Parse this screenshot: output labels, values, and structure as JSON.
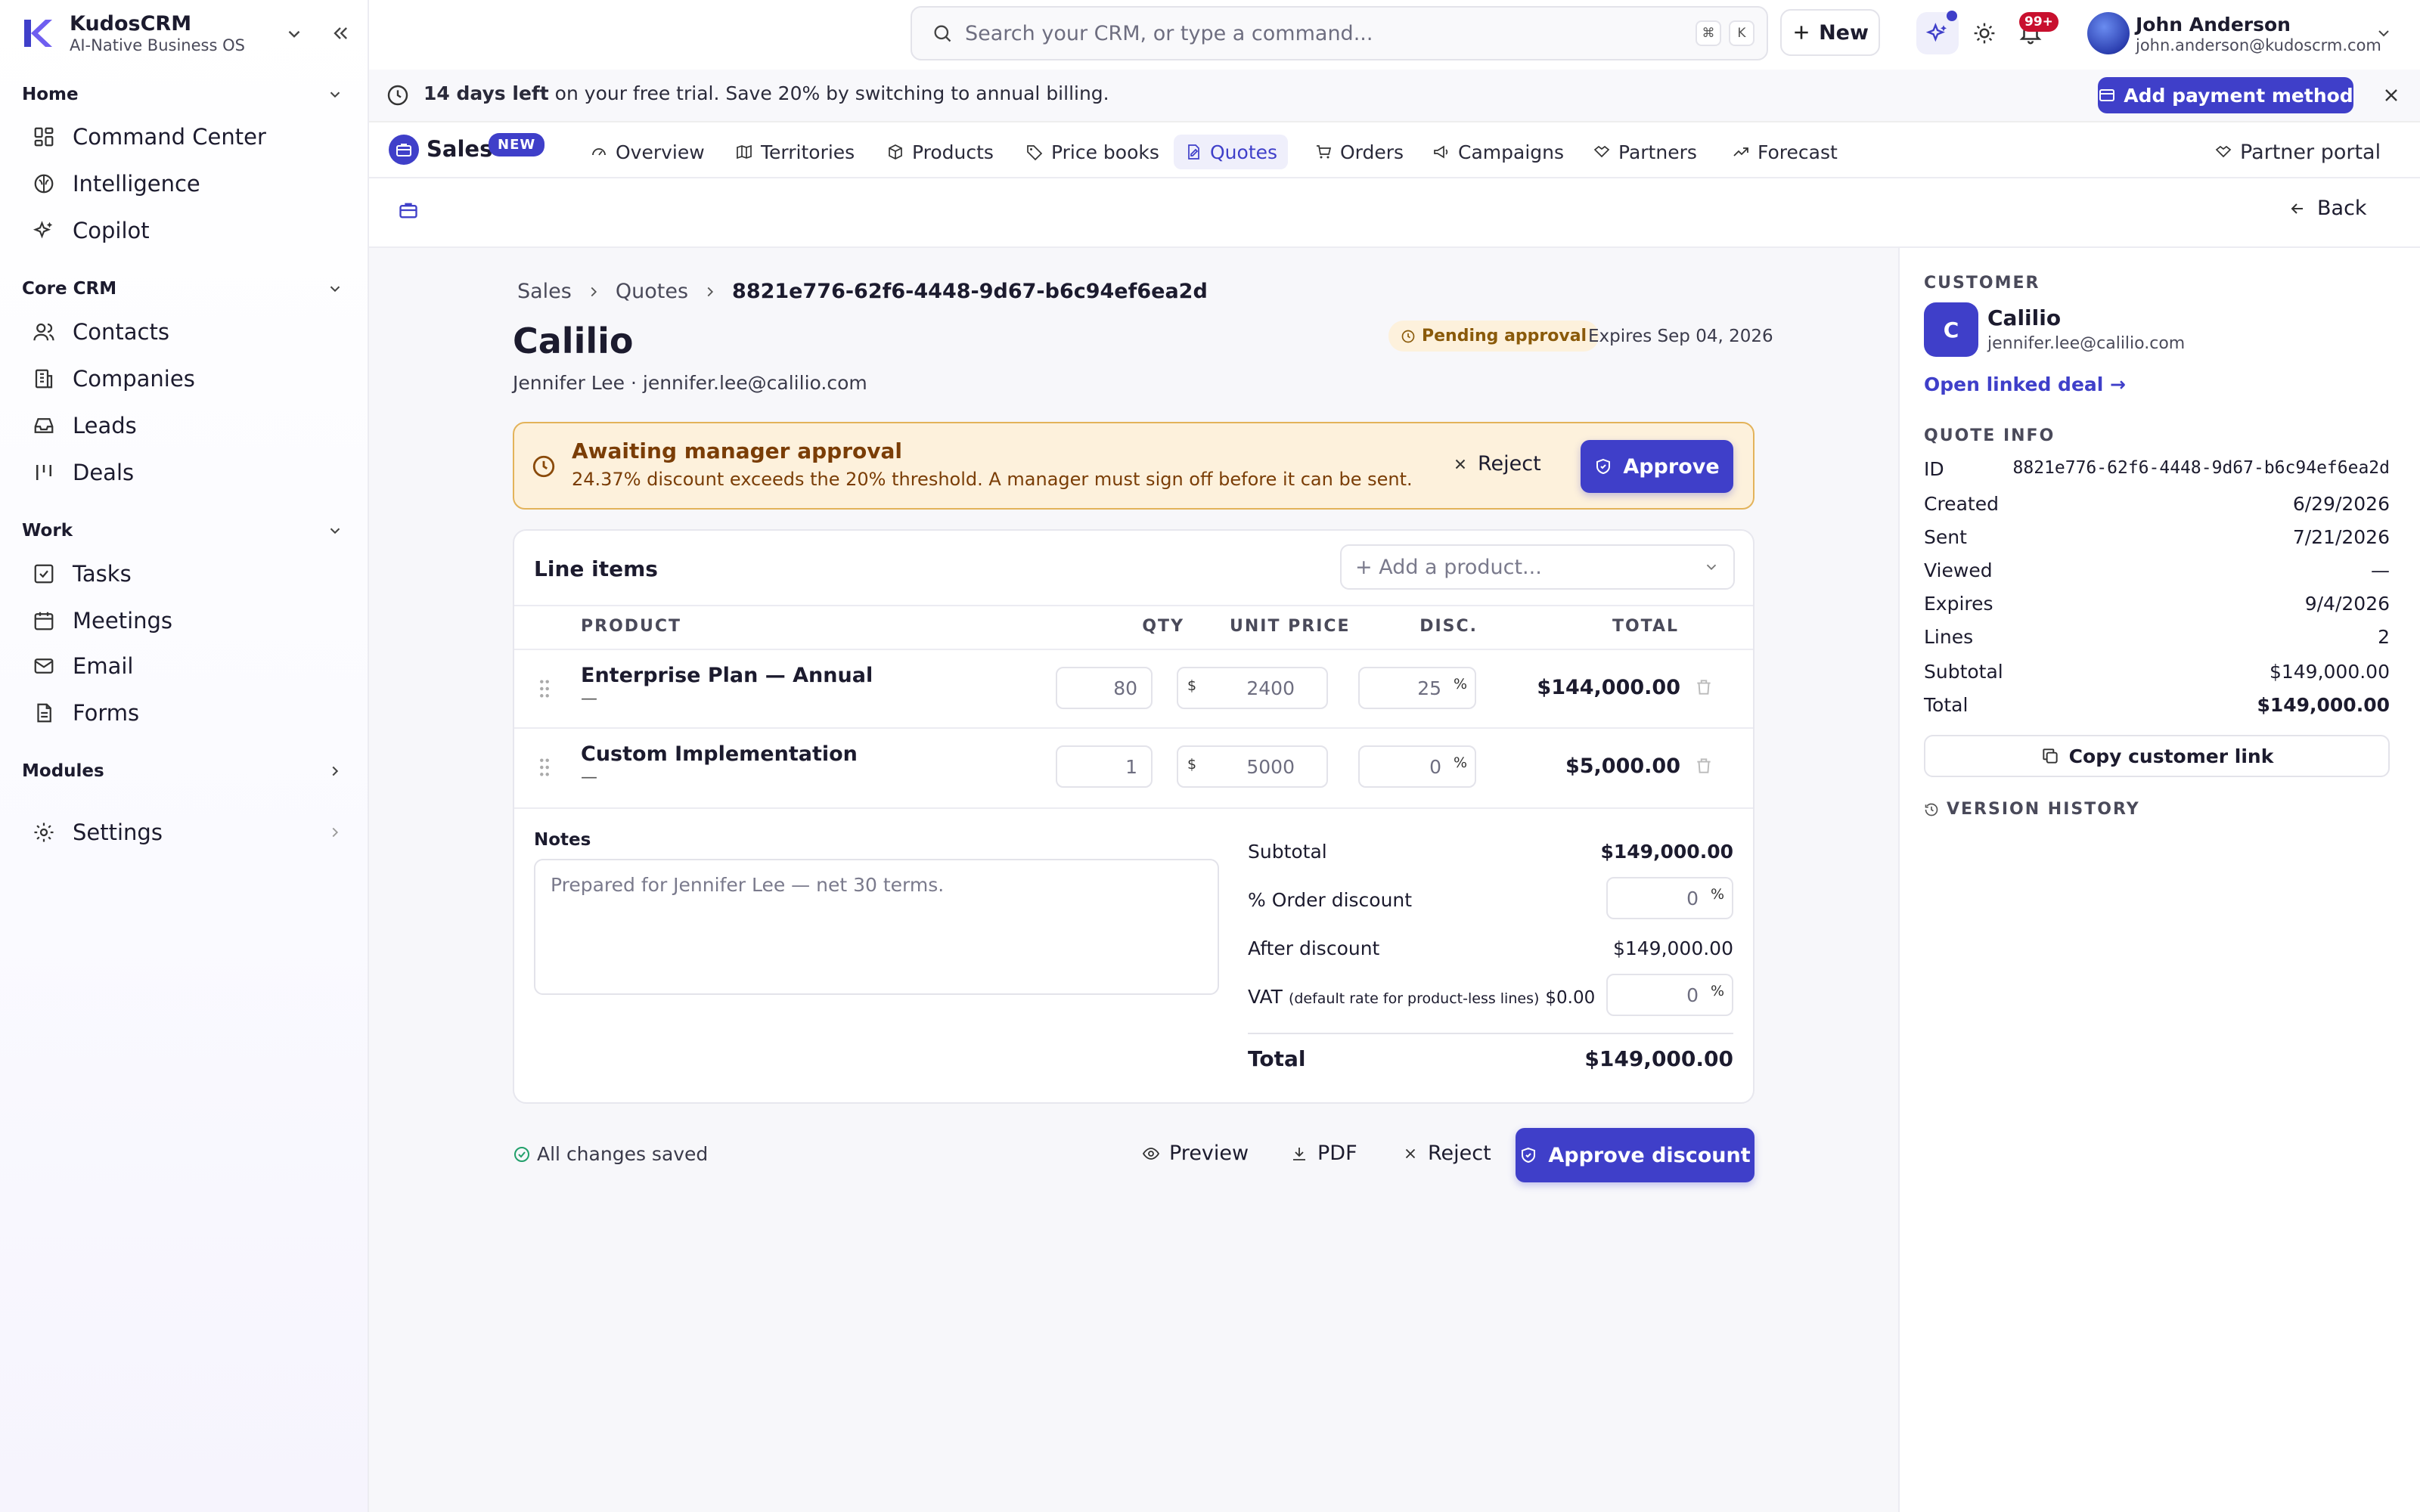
{
  "app": {
    "name": "KudosCRM",
    "subtitle": "AI-Native Business OS"
  },
  "sidebar": {
    "sections": [
      {
        "label": "Home",
        "items": [
          {
            "label": "Command Center"
          },
          {
            "label": "Intelligence"
          },
          {
            "label": "Copilot"
          }
        ]
      },
      {
        "label": "Core CRM",
        "items": [
          {
            "label": "Contacts"
          },
          {
            "label": "Companies"
          },
          {
            "label": "Leads"
          },
          {
            "label": "Deals"
          }
        ]
      },
      {
        "label": "Work",
        "items": [
          {
            "label": "Tasks"
          },
          {
            "label": "Meetings"
          },
          {
            "label": "Email"
          },
          {
            "label": "Forms"
          }
        ]
      },
      {
        "label": "Modules",
        "items": []
      }
    ],
    "settings_label": "Settings"
  },
  "topbar": {
    "search_placeholder": "Search your CRM, or type a command...",
    "kbd1": "⌘",
    "kbd2": "K",
    "new_label": "New",
    "notif_count": "99+",
    "user_name": "John Anderson",
    "user_email": "john.anderson@kudoscrm.com"
  },
  "banner": {
    "bold": "14 days left",
    "text": " on your free trial. Save 20% by switching to annual billing.",
    "button": "Add payment method"
  },
  "module": {
    "name": "Sales",
    "badge": "NEW"
  },
  "tabs": [
    {
      "label": "Overview"
    },
    {
      "label": "Territories"
    },
    {
      "label": "Products"
    },
    {
      "label": "Price books"
    },
    {
      "label": "Quotes"
    },
    {
      "label": "Orders"
    },
    {
      "label": "Campaigns"
    },
    {
      "label": "Partners"
    },
    {
      "label": "Forecast"
    }
  ],
  "partner_portal": "Partner portal",
  "back_label": "Back",
  "breadcrumb": {
    "a": "Sales",
    "b": "Quotes",
    "c": "8821e776-62f6-4448-9d67-b6c94ef6ea2d"
  },
  "quote": {
    "title": "Calilio",
    "contact": "Jennifer Lee · jennifer.lee@calilio.com",
    "status": "Pending approval",
    "expires": "Expires Sep 04, 2026"
  },
  "alert": {
    "title": "Awaiting manager approval",
    "text": "24.37% discount exceeds the 20% threshold. A manager must sign off before it can be sent.",
    "reject": "Reject",
    "approve": "Approve"
  },
  "line_items": {
    "title": "Line items",
    "add_placeholder": "+ Add a product...",
    "headers": {
      "product": "PRODUCT",
      "qty": "QTY",
      "unit": "UNIT PRICE",
      "disc": "DISC.",
      "total": "TOTAL"
    },
    "rows": [
      {
        "name": "Enterprise Plan — Annual",
        "sub": "—",
        "qty": "80",
        "cur": "$",
        "unit": "2400",
        "disc": "25",
        "pct": "%",
        "total": "$144,000.00"
      },
      {
        "name": "Custom Implementation",
        "sub": "—",
        "qty": "1",
        "cur": "$",
        "unit": "5000",
        "disc": "0",
        "pct": "%",
        "total": "$5,000.00"
      }
    ]
  },
  "notes": {
    "label": "Notes",
    "placeholder": "Prepared for Jennifer Lee — net 30 terms."
  },
  "totals": {
    "subtotal_label": "Subtotal",
    "subtotal": "$149,000.00",
    "order_discount_label": "% Order discount",
    "order_discount": "0",
    "pct": "%",
    "after_label": "After discount",
    "after": "$149,000.00",
    "vat_label": "VAT",
    "vat_note": "(default rate for product-less lines)",
    "vat_amount": "$0.00",
    "vat": "0",
    "total_label": "Total",
    "total": "$149,000.00"
  },
  "footer": {
    "saved": "All changes saved",
    "preview": "Preview",
    "pdf": "PDF",
    "reject": "Reject",
    "approve_discount": "Approve discount"
  },
  "customer": {
    "section": "CUSTOMER",
    "initial": "C",
    "name": "Calilio",
    "email": "jennifer.lee@calilio.com",
    "linked": "Open linked deal →"
  },
  "quote_info": {
    "section": "QUOTE INFO",
    "rows": [
      {
        "label": "ID",
        "value": "8821e776-62f6-4448-9d67-b6c94ef6ea2d"
      },
      {
        "label": "Created",
        "value": "6/29/2026"
      },
      {
        "label": "Sent",
        "value": "7/21/2026"
      },
      {
        "label": "Viewed",
        "value": "—"
      },
      {
        "label": "Expires",
        "value": "9/4/2026"
      },
      {
        "label": "Lines",
        "value": "2"
      },
      {
        "label": "Subtotal",
        "value": "$149,000.00"
      },
      {
        "label": "Total",
        "value": "$149,000.00"
      }
    ],
    "copy_link": "Copy customer link",
    "version_history": "VERSION HISTORY"
  },
  "colors": {
    "accent": "#3f3fc9",
    "warning_bg": "#fdf1dc",
    "warning_border": "#e3b35a",
    "success": "#22a06b"
  }
}
